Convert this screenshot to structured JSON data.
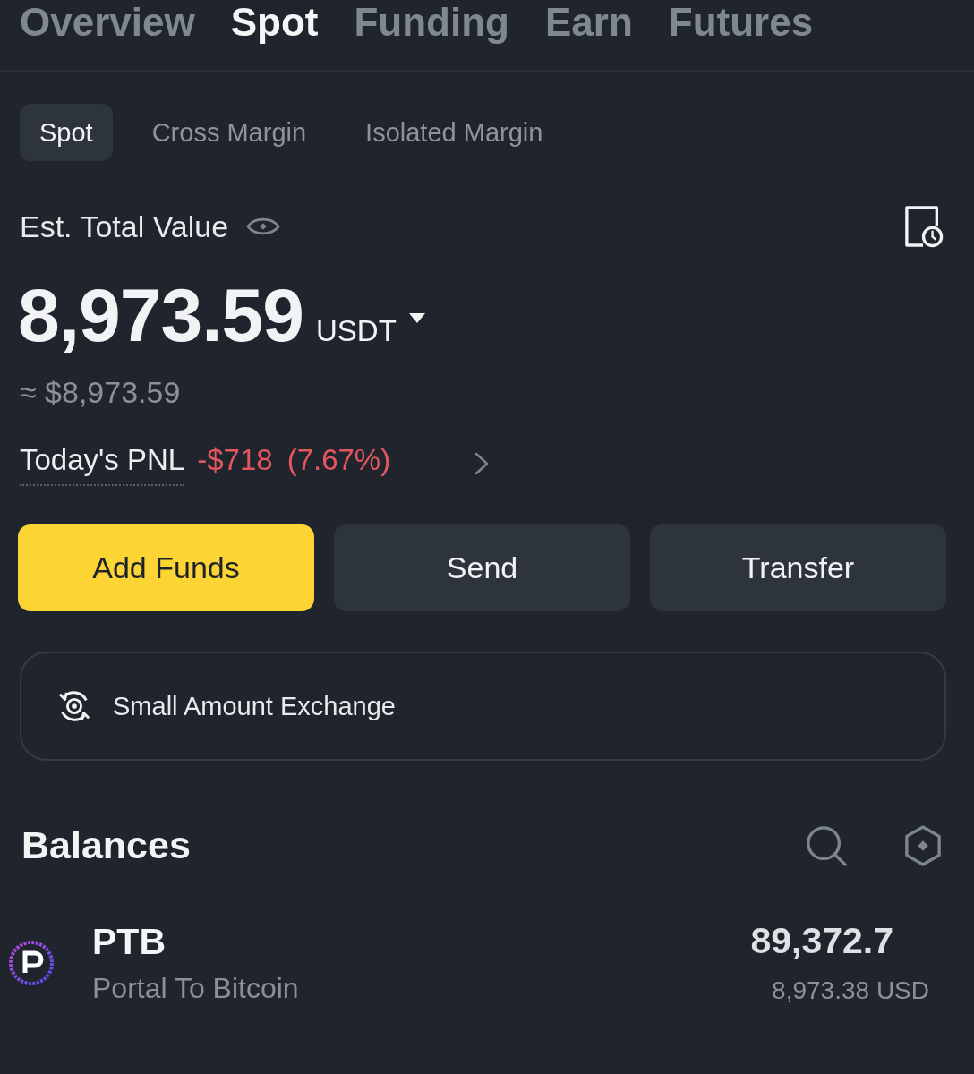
{
  "top_tabs": [
    {
      "label": "Overview",
      "selected": false
    },
    {
      "label": "Spot",
      "selected": true
    },
    {
      "label": "Funding",
      "selected": false
    },
    {
      "label": "Earn",
      "selected": false
    },
    {
      "label": "Futures",
      "selected": false
    }
  ],
  "sub_tabs": [
    {
      "label": "Spot",
      "selected": true
    },
    {
      "label": "Cross Margin",
      "selected": false
    },
    {
      "label": "Isolated Margin",
      "selected": false
    }
  ],
  "summary": {
    "label": "Est. Total Value",
    "amount": "8,973.59",
    "currency": "USDT",
    "approx": "≈ $8,973.59",
    "pnl_label": "Today's PNL",
    "pnl_value": "-$718",
    "pnl_percent": "(7.67%)"
  },
  "actions": [
    {
      "label": "Add Funds",
      "kind": "primary"
    },
    {
      "label": "Send",
      "kind": "secondary"
    },
    {
      "label": "Transfer",
      "kind": "secondary"
    }
  ],
  "small_exchange": {
    "label": "Small Amount Exchange"
  },
  "balances": {
    "title": "Balances",
    "rows": [
      {
        "symbol": "PTB",
        "name": "Portal To Bitcoin",
        "amount": "89,372.7",
        "value": "8,973.38 USD"
      }
    ]
  }
}
